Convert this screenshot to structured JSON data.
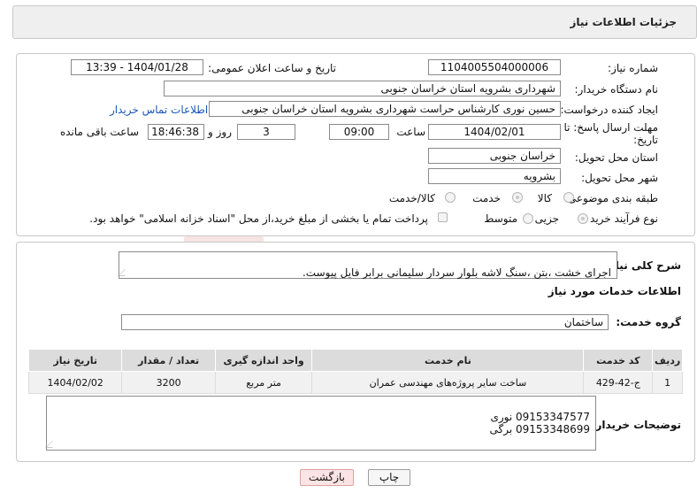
{
  "header": {
    "title": "جزئیات اطلاعات نیاز"
  },
  "form": {
    "need_number_label": "شماره نیاز:",
    "need_number": "1104005504000006",
    "announce_label": "تاریخ و ساعت اعلان عمومی:",
    "announce_value": "1404/01/28 - 13:39",
    "buyer_org_label": "نام دستگاه خریدار:",
    "buyer_org": "شهرداری بشرویه استان خراسان جنوبی",
    "creator_label": "ایجاد کننده درخواست:",
    "creator": "حسین نوری کارشناس حراست شهرداری بشرویه استان خراسان جنوبی",
    "contact_link": "اطلاعات تماس خریدار",
    "deadline_label_1": "مهلت ارسال پاسخ: تا",
    "deadline_label_2": "تاریخ:",
    "deadline_date": "1404/02/01",
    "time_label": "ساعت",
    "deadline_time": "09:00",
    "days_value": "3",
    "days_label": "روز و",
    "remaining_time": "18:46:38",
    "remaining_label": "ساعت باقی مانده",
    "province_label": "استان محل تحویل:",
    "province": "خراسان جنوبی",
    "city_label": "شهر محل تحویل:",
    "city": "بشرویه",
    "category_label": "طبقه بندی موضوعی:",
    "category_options": [
      "کالا",
      "خدمت",
      "کالا/خدمت"
    ],
    "category_selected": "خدمت",
    "process_label": "نوع فرآیند خرید :",
    "process_options": [
      "جزیی",
      "متوسط"
    ],
    "process_selected": "جزیی",
    "payment_note": "پرداخت تمام یا بخشی از مبلغ خرید،از محل \"اسناد خزانه اسلامی\" خواهد بود."
  },
  "need": {
    "summary_label": "شرح کلی نیاز:",
    "summary": "اجرای خشت ،بتن ،سنگ لاشه بلوار سردار سلیمانی برابر فایل پیوست.",
    "services_title": "اطلاعات خدمات مورد نیاز",
    "group_label": "گروه خدمت:",
    "group": "ساختمان"
  },
  "table": {
    "headers": [
      "ردیف",
      "کد خدمت",
      "نام خدمت",
      "واحد اندازه گیری",
      "تعداد / مقدار",
      "تاریخ نیاز"
    ],
    "rows": [
      [
        "1",
        "ج-42-429",
        "ساخت سایر پروژه‌های مهندسی عمران",
        "متر مربع",
        "3200",
        "1404/02/02"
      ]
    ]
  },
  "buyer_notes": {
    "label": "توضیحات خریدار:",
    "text": "09153347577 نوری\n09153348699 برگی"
  },
  "buttons": {
    "print": "چاپ",
    "back": "بازگشت"
  },
  "watermark": {
    "text": "AriaTender.neT"
  }
}
